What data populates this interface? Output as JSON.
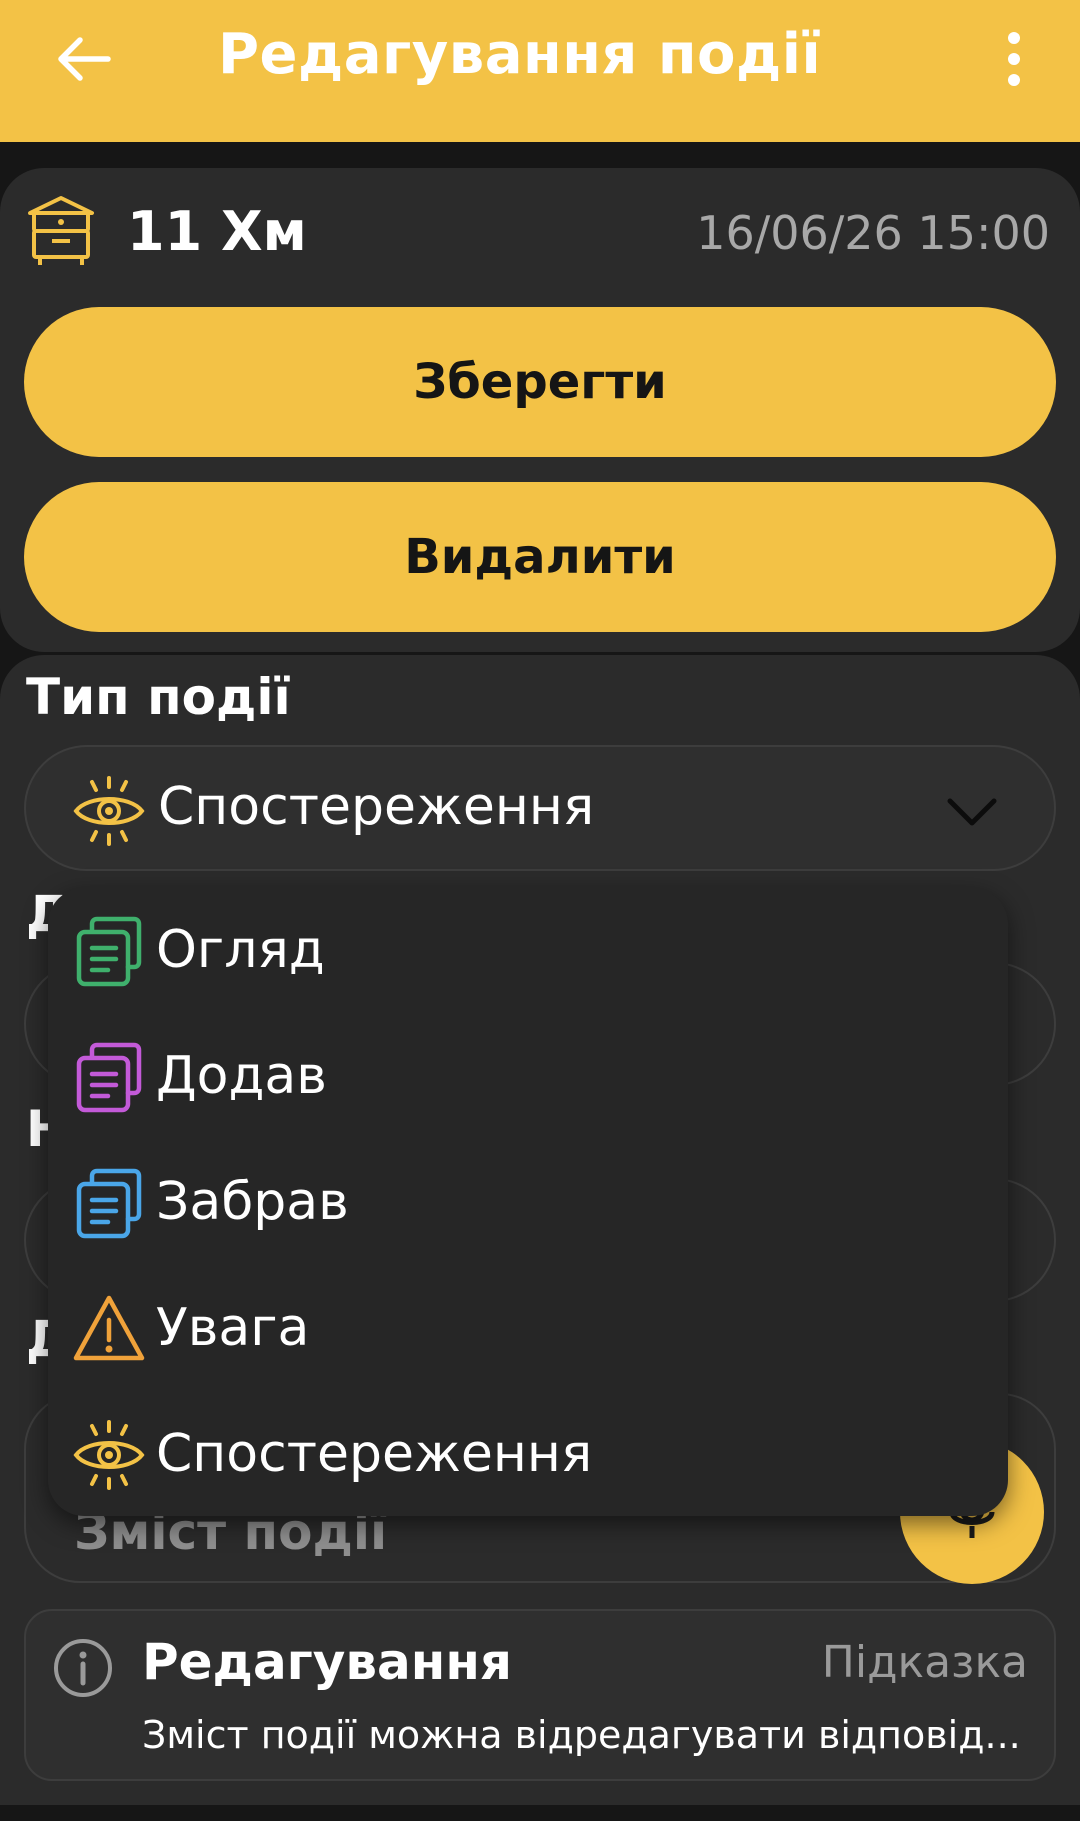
{
  "appbar": {
    "title": "Редагування події"
  },
  "hive": {
    "name": "11 Хм",
    "datetime": "16/06/26 15:00"
  },
  "actions": {
    "save_label": "Зберегти",
    "delete_label": "Видалити"
  },
  "event_type": {
    "label": "Тип події",
    "selected": "Спостереження"
  },
  "content": {
    "placeholder": "Зміст події"
  },
  "dropdown": {
    "options": [
      {
        "label": "Огляд",
        "icon": "notes-icon",
        "color": "#3fb06c"
      },
      {
        "label": "Додав",
        "icon": "notes-icon",
        "color": "#c35ad8"
      },
      {
        "label": "Забрав",
        "icon": "notes-icon",
        "color": "#4aa6e8"
      },
      {
        "label": "Увага",
        "icon": "warning-icon",
        "color": "#f0a23a"
      },
      {
        "label": "Спостереження",
        "icon": "eye-icon",
        "color": "#f3c246"
      }
    ]
  },
  "hint": {
    "title": "Редагування",
    "tag": "Підказка",
    "text": "Зміст події можна відредагувати відповід..."
  },
  "colors": {
    "accent": "#f3c246",
    "surface": "#2b2b2b",
    "background": "#161616"
  }
}
